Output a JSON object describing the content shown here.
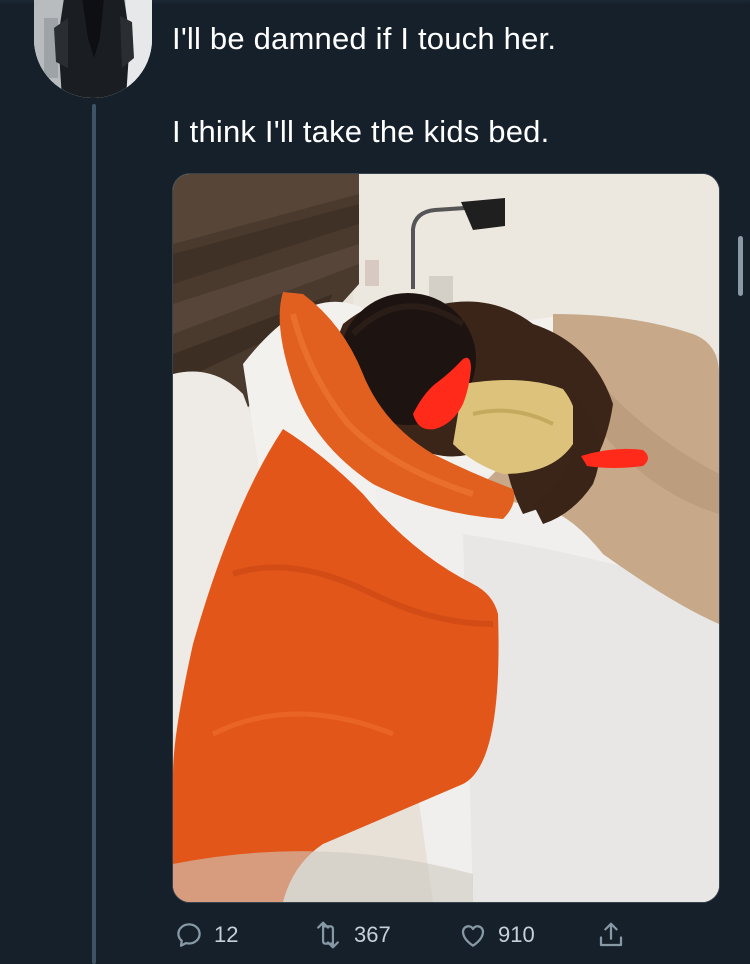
{
  "tweet": {
    "text_line_1": "I'll be damned if I touch her.",
    "text_line_2": "I think I'll take the kids bed."
  },
  "media": {
    "description_icon": "photo-image",
    "redaction_color": "#ff2a1a"
  },
  "actions": {
    "reply": {
      "icon": "reply-icon",
      "count": "12"
    },
    "retweet": {
      "icon": "retweet-icon",
      "count": "367"
    },
    "like": {
      "icon": "heart-icon",
      "count": "910"
    },
    "share": {
      "icon": "share-icon"
    }
  },
  "colors": {
    "background": "#15202b",
    "icon": "#8899a6",
    "thread_line": "#3d5466"
  }
}
